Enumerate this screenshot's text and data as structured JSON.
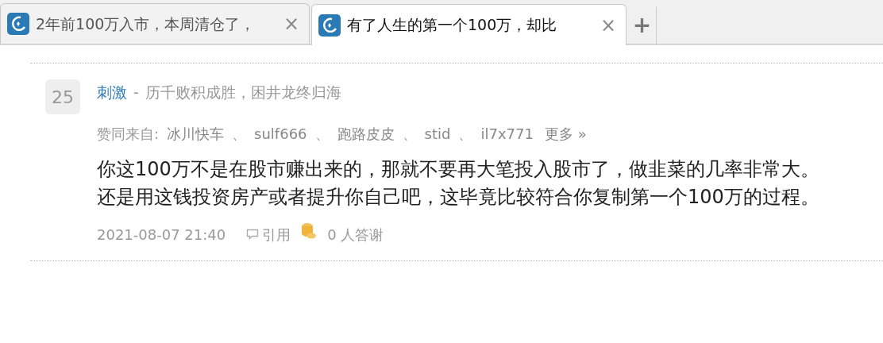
{
  "tabs": [
    {
      "title": "2年前100万入市，本周清仓了，",
      "selected": false,
      "close": "×"
    },
    {
      "title": "有了人生的第一个100万，却比",
      "selected": true,
      "close": "×"
    }
  ],
  "new_tab": "+",
  "reply": {
    "floor": "25",
    "author": "刺激",
    "separator": "-",
    "signature": "历千败积成胜，困井龙终归海",
    "votes_label": "赞同来自:",
    "voters": [
      "冰川快车",
      "sulf666",
      "跑路皮皮",
      "stid",
      "il7x771"
    ],
    "voter_separator": "、",
    "more": "更多 »",
    "paragraphs": [
      "你这100万不是在股市赚出来的，那就不要再大笔投入股市了，做韭菜的几率非常大。",
      "还是用这钱投资房产或者提升你自己吧，这毕竟比较符合你复制第一个100万的过程。"
    ],
    "time": "2021-08-07 21:40",
    "quote": "引用",
    "thanks": "0 人答谢"
  }
}
